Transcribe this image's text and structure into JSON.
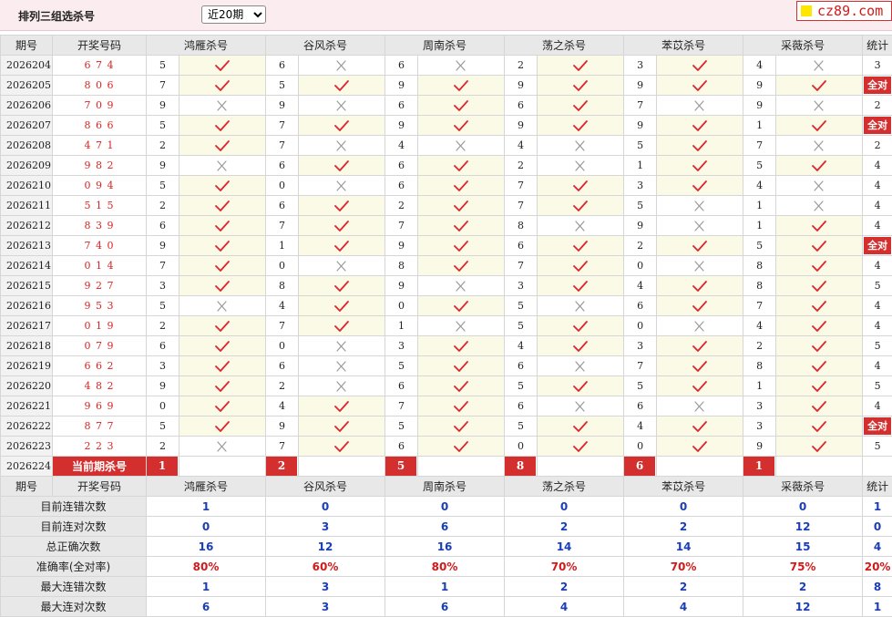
{
  "header": {
    "title": "排列三组选杀号",
    "period_select": "近20期",
    "logo_text": "cz89.com"
  },
  "table": {
    "col_period": "期号",
    "col_draw": "开奖号码",
    "experts": [
      "鸿雁杀号",
      "谷风杀号",
      "周南杀号",
      "荡之杀号",
      "苯苡杀号",
      "采薇杀号"
    ],
    "col_stat": "统计",
    "rows": [
      {
        "period": "2026204",
        "draw": "674",
        "picks": [
          [
            "5",
            "ok"
          ],
          [
            "6",
            "no"
          ],
          [
            "6",
            "no"
          ],
          [
            "2",
            "ok"
          ],
          [
            "3",
            "ok"
          ],
          [
            "4",
            "no"
          ]
        ],
        "stat": "3"
      },
      {
        "period": "2026205",
        "draw": "806",
        "picks": [
          [
            "7",
            "ok"
          ],
          [
            "5",
            "ok"
          ],
          [
            "9",
            "ok"
          ],
          [
            "9",
            "ok"
          ],
          [
            "9",
            "ok"
          ],
          [
            "9",
            "ok"
          ]
        ],
        "stat": "全对"
      },
      {
        "period": "2026206",
        "draw": "709",
        "picks": [
          [
            "9",
            "no"
          ],
          [
            "9",
            "no"
          ],
          [
            "6",
            "ok"
          ],
          [
            "6",
            "ok"
          ],
          [
            "7",
            "no"
          ],
          [
            "9",
            "no"
          ]
        ],
        "stat": "2"
      },
      {
        "period": "2026207",
        "draw": "866",
        "picks": [
          [
            "5",
            "ok"
          ],
          [
            "7",
            "ok"
          ],
          [
            "9",
            "ok"
          ],
          [
            "9",
            "ok"
          ],
          [
            "9",
            "ok"
          ],
          [
            "1",
            "ok"
          ]
        ],
        "stat": "全对"
      },
      {
        "period": "2026208",
        "draw": "471",
        "picks": [
          [
            "2",
            "ok"
          ],
          [
            "7",
            "no"
          ],
          [
            "4",
            "no"
          ],
          [
            "4",
            "no"
          ],
          [
            "5",
            "ok"
          ],
          [
            "7",
            "no"
          ]
        ],
        "stat": "2"
      },
      {
        "period": "2026209",
        "draw": "982",
        "picks": [
          [
            "9",
            "no"
          ],
          [
            "6",
            "ok"
          ],
          [
            "6",
            "ok"
          ],
          [
            "2",
            "no"
          ],
          [
            "1",
            "ok"
          ],
          [
            "5",
            "ok"
          ]
        ],
        "stat": "4"
      },
      {
        "period": "2026210",
        "draw": "094",
        "picks": [
          [
            "5",
            "ok"
          ],
          [
            "0",
            "no"
          ],
          [
            "6",
            "ok"
          ],
          [
            "7",
            "ok"
          ],
          [
            "3",
            "ok"
          ],
          [
            "4",
            "no"
          ]
        ],
        "stat": "4"
      },
      {
        "period": "2026211",
        "draw": "515",
        "picks": [
          [
            "2",
            "ok"
          ],
          [
            "6",
            "ok"
          ],
          [
            "2",
            "ok"
          ],
          [
            "7",
            "ok"
          ],
          [
            "5",
            "no"
          ],
          [
            "1",
            "no"
          ]
        ],
        "stat": "4"
      },
      {
        "period": "2026212",
        "draw": "839",
        "picks": [
          [
            "6",
            "ok"
          ],
          [
            "7",
            "ok"
          ],
          [
            "7",
            "ok"
          ],
          [
            "8",
            "no"
          ],
          [
            "9",
            "no"
          ],
          [
            "1",
            "ok"
          ]
        ],
        "stat": "4"
      },
      {
        "period": "2026213",
        "draw": "740",
        "picks": [
          [
            "9",
            "ok"
          ],
          [
            "1",
            "ok"
          ],
          [
            "9",
            "ok"
          ],
          [
            "6",
            "ok"
          ],
          [
            "2",
            "ok"
          ],
          [
            "5",
            "ok"
          ]
        ],
        "stat": "全对"
      },
      {
        "period": "2026214",
        "draw": "014",
        "picks": [
          [
            "7",
            "ok"
          ],
          [
            "0",
            "no"
          ],
          [
            "8",
            "ok"
          ],
          [
            "7",
            "ok"
          ],
          [
            "0",
            "no"
          ],
          [
            "8",
            "ok"
          ]
        ],
        "stat": "4"
      },
      {
        "period": "2026215",
        "draw": "927",
        "picks": [
          [
            "3",
            "ok"
          ],
          [
            "8",
            "ok"
          ],
          [
            "9",
            "no"
          ],
          [
            "3",
            "ok"
          ],
          [
            "4",
            "ok"
          ],
          [
            "8",
            "ok"
          ]
        ],
        "stat": "5"
      },
      {
        "period": "2026216",
        "draw": "953",
        "picks": [
          [
            "5",
            "no"
          ],
          [
            "4",
            "ok"
          ],
          [
            "0",
            "ok"
          ],
          [
            "5",
            "no"
          ],
          [
            "6",
            "ok"
          ],
          [
            "7",
            "ok"
          ]
        ],
        "stat": "4"
      },
      {
        "period": "2026217",
        "draw": "019",
        "picks": [
          [
            "2",
            "ok"
          ],
          [
            "7",
            "ok"
          ],
          [
            "1",
            "no"
          ],
          [
            "5",
            "ok"
          ],
          [
            "0",
            "no"
          ],
          [
            "4",
            "ok"
          ]
        ],
        "stat": "4"
      },
      {
        "period": "2026218",
        "draw": "079",
        "picks": [
          [
            "6",
            "ok"
          ],
          [
            "0",
            "no"
          ],
          [
            "3",
            "ok"
          ],
          [
            "4",
            "ok"
          ],
          [
            "3",
            "ok"
          ],
          [
            "2",
            "ok"
          ]
        ],
        "stat": "5"
      },
      {
        "period": "2026219",
        "draw": "662",
        "picks": [
          [
            "3",
            "ok"
          ],
          [
            "6",
            "no"
          ],
          [
            "5",
            "ok"
          ],
          [
            "6",
            "no"
          ],
          [
            "7",
            "ok"
          ],
          [
            "8",
            "ok"
          ]
        ],
        "stat": "4"
      },
      {
        "period": "2026220",
        "draw": "482",
        "picks": [
          [
            "9",
            "ok"
          ],
          [
            "2",
            "no"
          ],
          [
            "6",
            "ok"
          ],
          [
            "5",
            "ok"
          ],
          [
            "5",
            "ok"
          ],
          [
            "1",
            "ok"
          ]
        ],
        "stat": "5"
      },
      {
        "period": "2026221",
        "draw": "969",
        "picks": [
          [
            "0",
            "ok"
          ],
          [
            "4",
            "ok"
          ],
          [
            "7",
            "ok"
          ],
          [
            "6",
            "no"
          ],
          [
            "6",
            "no"
          ],
          [
            "3",
            "ok"
          ]
        ],
        "stat": "4"
      },
      {
        "period": "2026222",
        "draw": "877",
        "picks": [
          [
            "5",
            "ok"
          ],
          [
            "9",
            "ok"
          ],
          [
            "5",
            "ok"
          ],
          [
            "5",
            "ok"
          ],
          [
            "4",
            "ok"
          ],
          [
            "3",
            "ok"
          ]
        ],
        "stat": "全对"
      },
      {
        "period": "2026223",
        "draw": "223",
        "picks": [
          [
            "2",
            "no"
          ],
          [
            "7",
            "ok"
          ],
          [
            "6",
            "ok"
          ],
          [
            "0",
            "ok"
          ],
          [
            "0",
            "ok"
          ],
          [
            "9",
            "ok"
          ]
        ],
        "stat": "5"
      }
    ],
    "current": {
      "period": "2026224",
      "label": "当前期杀号",
      "picks": [
        "1",
        "2",
        "5",
        "8",
        "6",
        "1"
      ]
    },
    "stats": [
      {
        "label": "目前连错次数",
        "values": [
          "1",
          "0",
          "0",
          "0",
          "0",
          "0",
          "1"
        ],
        "red": false
      },
      {
        "label": "目前连对次数",
        "values": [
          "0",
          "3",
          "6",
          "2",
          "2",
          "12",
          "0"
        ],
        "red": false
      },
      {
        "label": "总正确次数",
        "values": [
          "16",
          "12",
          "16",
          "14",
          "14",
          "15",
          "4"
        ],
        "red": false
      },
      {
        "label": "准确率(全对率)",
        "values": [
          "80%",
          "60%",
          "80%",
          "70%",
          "70%",
          "75%",
          "20%"
        ],
        "red": true
      },
      {
        "label": "最大连错次数",
        "values": [
          "1",
          "3",
          "1",
          "2",
          "2",
          "2",
          "8"
        ],
        "red": false
      },
      {
        "label": "最大连对次数",
        "values": [
          "6",
          "3",
          "6",
          "4",
          "4",
          "12",
          "1"
        ],
        "red": false
      }
    ]
  }
}
